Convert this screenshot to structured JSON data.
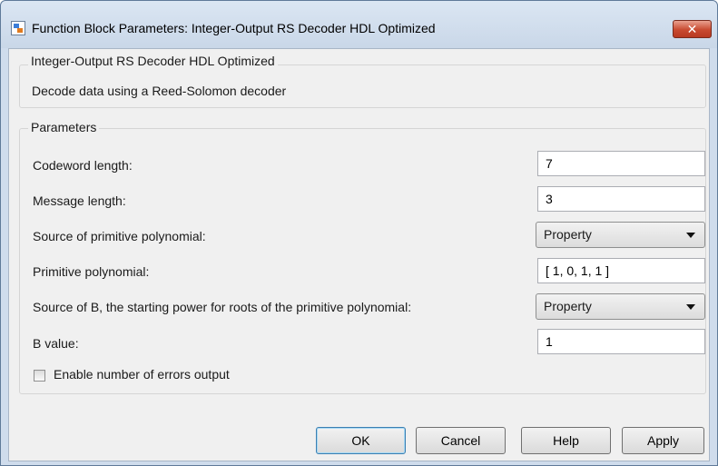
{
  "window": {
    "title": "Function Block Parameters: Integer-Output RS Decoder HDL Optimized",
    "close_glyph": "✕"
  },
  "block": {
    "name": "Integer-Output RS Decoder HDL Optimized",
    "description": "Decode data using a Reed-Solomon decoder"
  },
  "params": {
    "group_title": "Parameters",
    "codeword_length": {
      "label": "Codeword length:",
      "value": "7"
    },
    "message_length": {
      "label": "Message length:",
      "value": "3"
    },
    "source_primitive_polynomial": {
      "label": "Source of primitive polynomial:",
      "value": "Property"
    },
    "primitive_polynomial": {
      "label": "Primitive polynomial:",
      "value": "[ 1, 0, 1, 1 ]"
    },
    "source_b": {
      "label": "Source of B, the starting power for roots of the primitive polynomial:",
      "value": "Property"
    },
    "b_value": {
      "label": "B value:",
      "value": "1"
    },
    "enable_errors_output": {
      "label": "Enable number of errors output",
      "checked": false
    }
  },
  "buttons": {
    "ok": "OK",
    "cancel": "Cancel",
    "help": "Help",
    "apply": "Apply"
  }
}
